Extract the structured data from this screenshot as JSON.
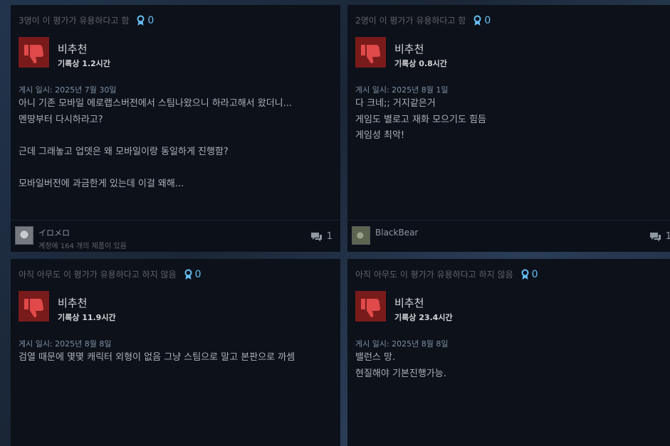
{
  "reviews": [
    {
      "helpful_text": "3명이 이 평가가 유용하다고 함",
      "awards": "0",
      "verdict": "비추천",
      "hours": "기록상 1.2시간",
      "posted": "게시 일시: 2025년 7월 30일",
      "lines": [
        "아니 기존 모바일 에로랩스버전에서 스팀나왔으니 하라고해서 왔더니...",
        "멘땅부터 다시하라고?",
        "",
        "근데 그래놓고 업뎃은 왜 모바일이랑 동일하게 진행함?",
        "",
        "모바일버전에 과금한게 있는데 이걸 왜해..."
      ],
      "username": "イロメロ",
      "owned": "계정에 164 개의 제품이 있음",
      "comments": "1"
    },
    {
      "helpful_text": "2명이 이 평가가 유용하다고 함",
      "awards": "0",
      "verdict": "비추천",
      "hours": "기록상 0.8시간",
      "posted": "게시 일시: 2025년 8월 1일",
      "lines": [
        "다 크네;; 거지같은거",
        "게임도 별로고 재화 모으기도 힘듬",
        "게임성 최악!"
      ],
      "username": "BlackBear",
      "comments": "1"
    },
    {
      "helpful_text": "아직 아무도 이 평가가 유용하다고 하지 않음",
      "awards": "0",
      "verdict": "비추천",
      "hours": "기록상 11.9시간",
      "posted": "게시 일시: 2025년 8월 8일",
      "lines": [
        "검열 때문에 몇몇 캐릭터 외형이 없음 그냥 스팀으로 말고 본판으로 까셈"
      ]
    },
    {
      "helpful_text": "아직 아무도 이 평가가 유용하다고 하지 않음",
      "awards": "0",
      "verdict": "비추천",
      "hours": "기록상 23.4시간",
      "posted": "게시 일시: 2025년 8월 8일",
      "lines": [
        "밸런스 망.",
        "현질해야 기본진행가능."
      ]
    }
  ],
  "icons": {
    "verdict": "thumbs-down-icon",
    "award": "award-ribbon-icon",
    "comments": "speech-bubble-icon"
  },
  "colors": {
    "card_bg": "#0c111a",
    "thumb_bg": "#791b1b",
    "thumb_icon": "#e04a4a",
    "award_blue": "#66c0f4"
  }
}
